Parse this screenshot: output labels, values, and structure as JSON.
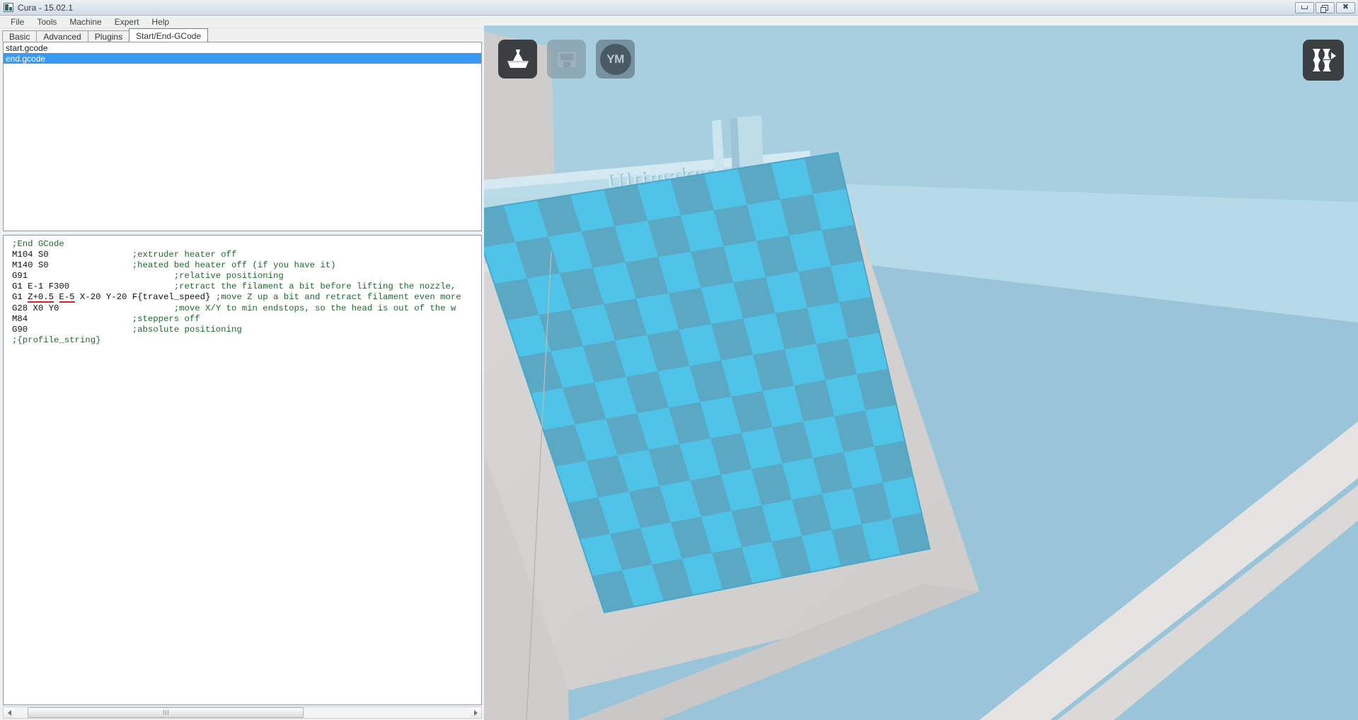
{
  "window": {
    "title": "Cura - 15.02.1",
    "icon": "cura-app-icon",
    "controls": {
      "minimize": "minimize-button",
      "restore": "restore-button",
      "close": "close-button"
    }
  },
  "menubar": {
    "items": [
      "File",
      "Tools",
      "Machine",
      "Expert",
      "Help"
    ]
  },
  "tabs": [
    {
      "label": "Basic",
      "active": false
    },
    {
      "label": "Advanced",
      "active": false
    },
    {
      "label": "Plugins",
      "active": false
    },
    {
      "label": "Start/End-GCode",
      "active": true
    }
  ],
  "gcode_file_list": {
    "items": [
      {
        "name": "start.gcode",
        "selected": false
      },
      {
        "name": "end.gcode",
        "selected": true
      }
    ]
  },
  "gcode_editor": {
    "filename": "end.gcode",
    "lines": [
      {
        "code": ";End GCode",
        "comment": "",
        "comment_col": 0,
        "code_is_comment": true
      },
      {
        "code": "M104 S0",
        "comment": ";extruder heater off",
        "comment_col": 23
      },
      {
        "code": "M140 S0",
        "comment": ";heated bed heater off (if you have it)",
        "comment_col": 23
      },
      {
        "code": "G91",
        "comment": ";relative positioning",
        "comment_col": 31
      },
      {
        "code": "G1 E-1 F300",
        "comment": ";retract the filament a bit before lifting the nozzle,",
        "comment_col": 31
      },
      {
        "code": "G1 Z+0.5 E-5 X-20 Y-20 F{travel_speed}",
        "comment": ";move Z up a bit and retract filament even more",
        "comment_col": 39,
        "underlines": [
          "Z+0.5",
          "E-5"
        ]
      },
      {
        "code": "G28 X0 Y0",
        "comment": ";move X/Y to min endstops, so the head is out of the w",
        "comment_col": 31
      },
      {
        "code": "M84",
        "comment": ";steppers off",
        "comment_col": 23
      },
      {
        "code": "G90",
        "comment": ";absolute positioning",
        "comment_col": 23
      },
      {
        "code": ";{profile_string}",
        "comment": "",
        "comment_col": 0,
        "code_is_comment": true
      }
    ]
  },
  "scrollbar": {
    "left_arrow": "scroll-left-arrow",
    "right_arrow": "scroll-right-arrow",
    "thumb": "horizontal-scroll-thumb"
  },
  "viewport": {
    "toolbar": [
      {
        "name": "load-model-button",
        "icon": "load-model-icon",
        "label": "",
        "state": "enabled"
      },
      {
        "name": "save-toolpath-button",
        "icon": "save-floppy-icon",
        "label": "",
        "state": "disabled"
      },
      {
        "name": "youmagine-share-button",
        "icon": "youmagine-icon",
        "label": "YM",
        "state": "enabled"
      }
    ],
    "view_mode_button": {
      "name": "view-mode-button",
      "icon": "layers-view-icon"
    },
    "machine": {
      "brand_text": "Ultimaker",
      "build_plate": "checkered-build-plate"
    },
    "colors": {
      "background": "#9ac4da",
      "back_panel": "#b9dbe8",
      "back_panel_light": "#c8e4ef",
      "chassis": "#d5d3d1",
      "plate_light": "#4fc3e8",
      "plate_dark": "#5aa8c4"
    }
  },
  "theme": {
    "selection_blue": "#3a99f5",
    "comment_green": "#1e6b2c",
    "error_underline": "#e02020"
  }
}
